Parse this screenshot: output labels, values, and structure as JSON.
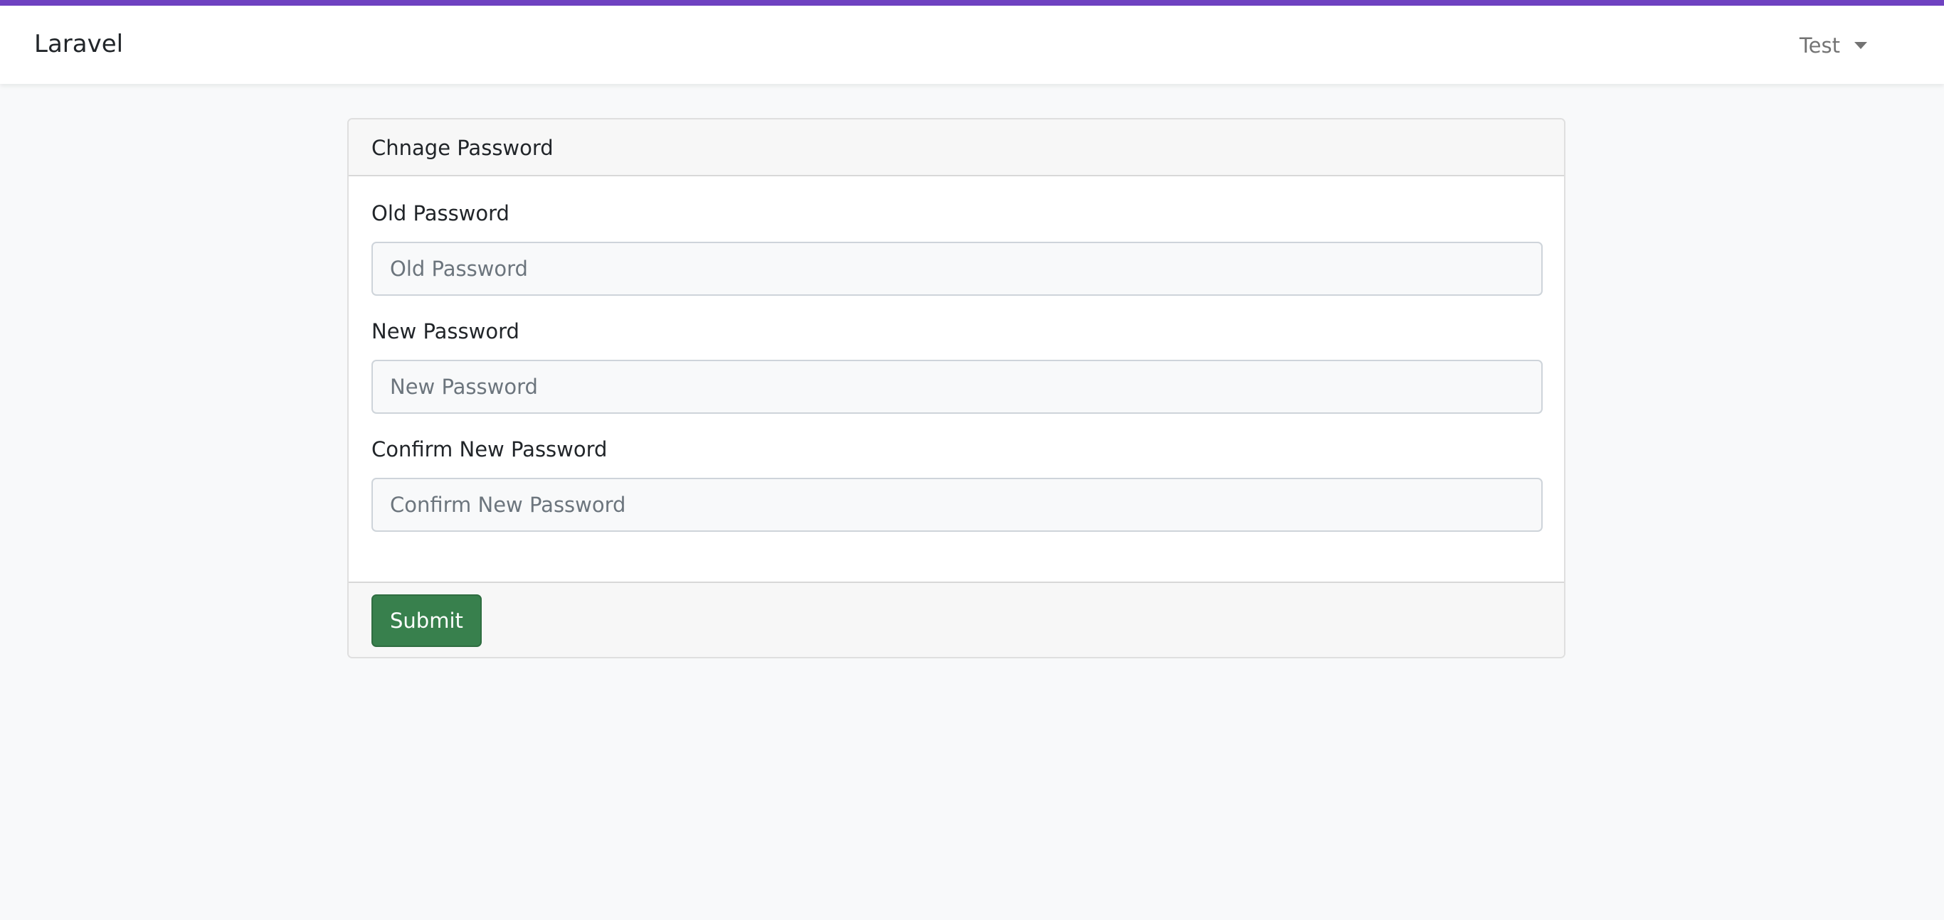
{
  "nav": {
    "brand": "Laravel",
    "user_name": "Test"
  },
  "card": {
    "title": "Chnage Password",
    "fields": [
      {
        "label": "Old Password",
        "placeholder": "Old Password",
        "value": ""
      },
      {
        "label": "New Password",
        "placeholder": "New Password",
        "value": ""
      },
      {
        "label": "Confirm New Password",
        "placeholder": "Confirm New Password",
        "value": ""
      }
    ],
    "submit_label": "Submit"
  },
  "colors": {
    "accent": "#6f42c1",
    "submit": "#38804d",
    "background": "#f8f9fa"
  },
  "icons": {
    "user_menu": "caret-down-icon"
  }
}
